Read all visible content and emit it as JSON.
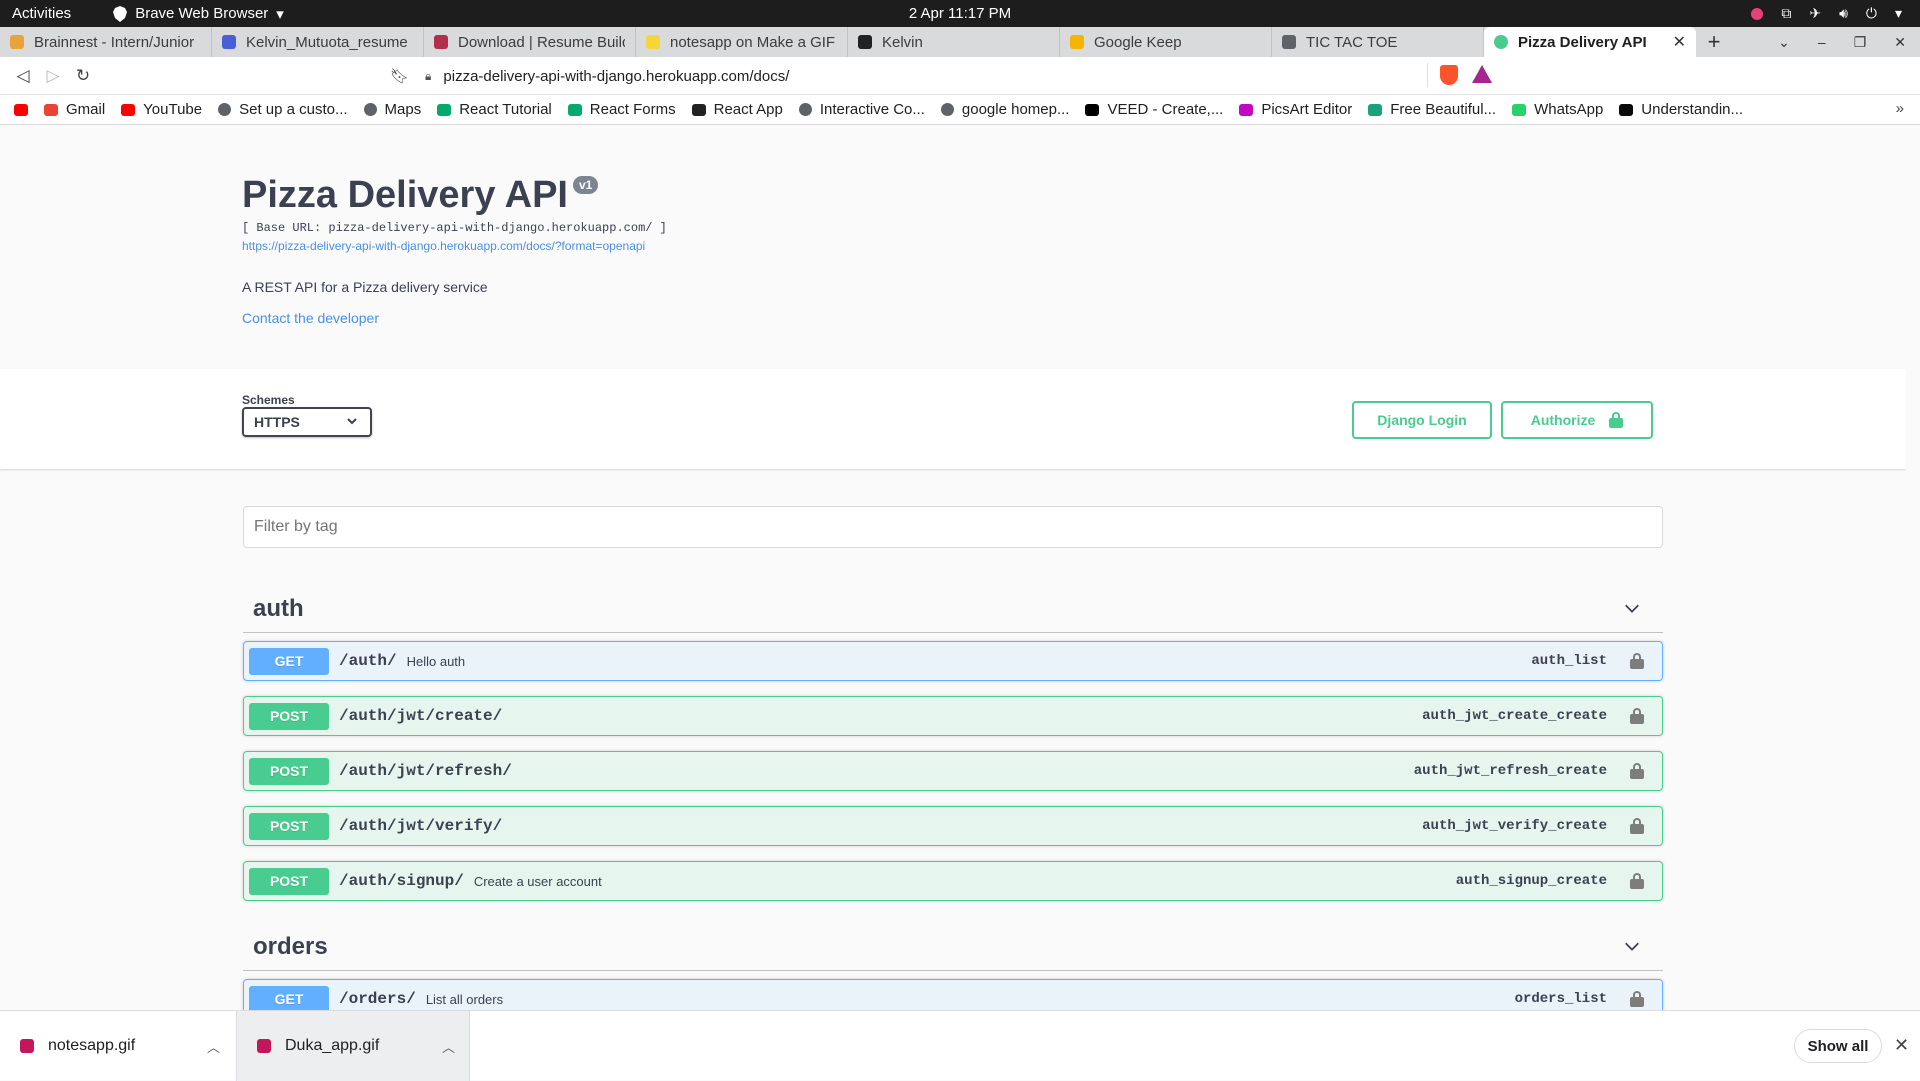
{
  "topbar": {
    "activities": "Activities",
    "app_name": "Brave Web Browser",
    "clock": "2 Apr  11:17 PM"
  },
  "tabs": [
    {
      "label": "Brainnest - Intern/Junior",
      "icon": "brainnest-favicon",
      "color": "#e8a33d"
    },
    {
      "label": "Kelvin_Mutuota_resume",
      "icon": "document-favicon",
      "color": "#4b5fd5"
    },
    {
      "label": "Download | Resume Build",
      "icon": "resume-favicon",
      "color": "#b0304c"
    },
    {
      "label": "notesapp on Make a GIF",
      "icon": "gif-favicon",
      "color": "#f5d63a"
    },
    {
      "label": "Kelvin",
      "icon": "k-favicon",
      "color": "#222222"
    },
    {
      "label": "Google Keep",
      "icon": "keep-favicon",
      "color": "#f6b400"
    },
    {
      "label": "TIC TAC TOE",
      "icon": "globe-favicon",
      "color": "#5f6368"
    },
    {
      "label": "Pizza Delivery API",
      "icon": "swagger-favicon",
      "color": "#49cc90",
      "active": true
    }
  ],
  "address": {
    "url": "pizza-delivery-api-with-django.herokuapp.com/docs/"
  },
  "bookmarks": [
    {
      "label": "",
      "icon": "youtube-icon",
      "color": "#ff0000"
    },
    {
      "label": "Gmail",
      "icon": "gmail-icon",
      "color": "#ea4335"
    },
    {
      "label": "YouTube",
      "icon": "youtube-icon",
      "color": "#ff0000"
    },
    {
      "label": "Set up a custo...",
      "icon": "globe-icon",
      "color": "#5f6368"
    },
    {
      "label": "Maps",
      "icon": "globe-icon",
      "color": "#5f6368"
    },
    {
      "label": "React Tutorial",
      "icon": "w3schools-icon",
      "color": "#04aa6d"
    },
    {
      "label": "React Forms",
      "icon": "w3schools-icon",
      "color": "#04aa6d"
    },
    {
      "label": "React App",
      "icon": "k-icon",
      "color": "#222222"
    },
    {
      "label": "Interactive Co...",
      "icon": "globe-icon",
      "color": "#5f6368"
    },
    {
      "label": "google homep...",
      "icon": "globe-icon",
      "color": "#5f6368"
    },
    {
      "label": "VEED - Create,...",
      "icon": "veed-icon",
      "color": "#000000"
    },
    {
      "label": "PicsArt Editor",
      "icon": "picsart-icon",
      "color": "#c209c1"
    },
    {
      "label": "Free Beautiful...",
      "icon": "freepik-icon",
      "color": "#1aa37a"
    },
    {
      "label": "WhatsApp",
      "icon": "whatsapp-icon",
      "color": "#25d366"
    },
    {
      "label": "Understandin...",
      "icon": "dev-icon",
      "color": "#0a0a0a"
    }
  ],
  "info": {
    "title": "Pizza Delivery API",
    "version": "v1",
    "base_url": "[ Base URL: pizza-delivery-api-with-django.herokuapp.com/ ]",
    "openapi_link": "https://pizza-delivery-api-with-django.herokuapp.com/docs/?format=openapi",
    "description": "A REST API for a Pizza delivery service",
    "contact": "Contact the developer"
  },
  "schemes": {
    "label": "Schemes",
    "selected": "HTTPS"
  },
  "buttons": {
    "django_login": "Django Login",
    "authorize": "Authorize"
  },
  "filter": {
    "placeholder": "Filter by tag"
  },
  "tags": [
    {
      "name": "auth",
      "operations": [
        {
          "method": "GET",
          "path": "/auth/",
          "summary": "Hello auth",
          "operation_id": "auth_list"
        },
        {
          "method": "POST",
          "path": "/auth/jwt/create/",
          "summary": "",
          "operation_id": "auth_jwt_create_create"
        },
        {
          "method": "POST",
          "path": "/auth/jwt/refresh/",
          "summary": "",
          "operation_id": "auth_jwt_refresh_create"
        },
        {
          "method": "POST",
          "path": "/auth/jwt/verify/",
          "summary": "",
          "operation_id": "auth_jwt_verify_create"
        },
        {
          "method": "POST",
          "path": "/auth/signup/",
          "summary": "Create a user account",
          "operation_id": "auth_signup_create"
        }
      ]
    },
    {
      "name": "orders",
      "operations": [
        {
          "method": "GET",
          "path": "/orders/",
          "summary": "List all orders",
          "operation_id": "orders_list"
        }
      ]
    }
  ],
  "downloads": [
    {
      "filename": "notesapp.gif"
    },
    {
      "filename": "Duka_app.gif"
    }
  ],
  "shelf": {
    "show_all": "Show all"
  }
}
